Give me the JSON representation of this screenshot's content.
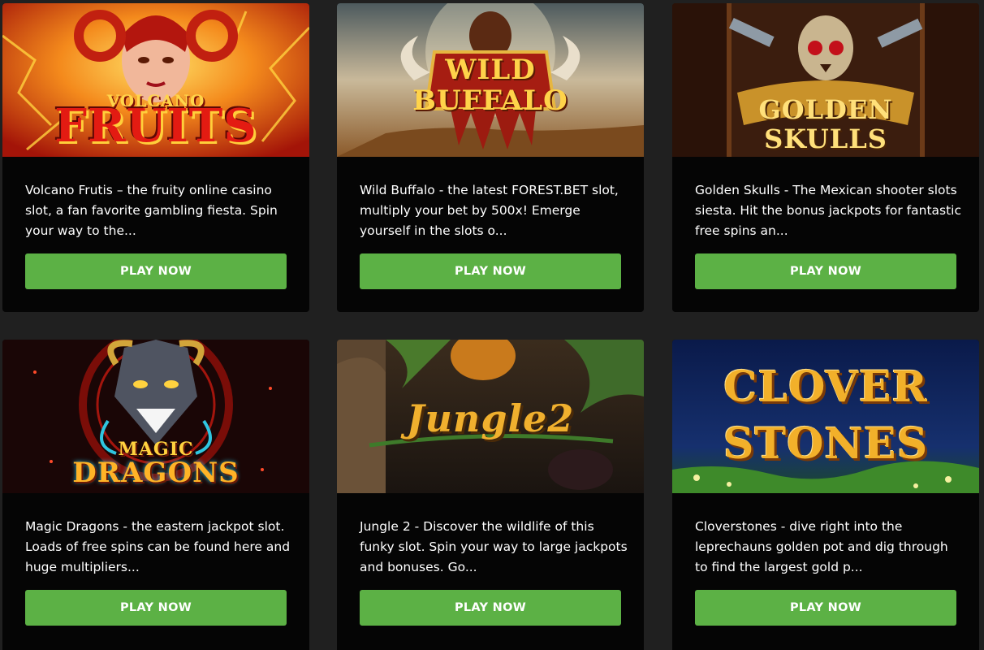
{
  "cards": [
    {
      "logo_line1": "VOLCANO",
      "logo_line2": "FRUITS",
      "description": "Volcano Frutis – the fruity online casino slot, a fan favorite gambling fiesta. Spin your way to the...",
      "button": "PLAY NOW"
    },
    {
      "logo_line1": "WILD",
      "logo_line2": "BUFFALO",
      "description": "Wild Buffalo - the latest FOREST.BET slot, multiply your bet by 500x! Emerge yourself in the slots o...",
      "button": "PLAY NOW"
    },
    {
      "logo_line1": "GOLDEN",
      "logo_line2": "SKULLS",
      "description": "Golden Skulls - The Mexican shooter slots siesta. Hit the bonus jackpots for fantastic free spins an...",
      "button": "PLAY NOW"
    },
    {
      "logo_line1": "MAGIC",
      "logo_line2": "DRAGONS",
      "description": "Magic Dragons - the eastern jackpot slot. Loads of free spins can be found here and huge multipliers...",
      "button": "PLAY NOW"
    },
    {
      "logo_line1": "Jungle2",
      "description": "Jungle 2 - Discover the wildlife of this funky slot. Spin your way to large jackpots and bonuses. Go...",
      "button": "PLAY NOW"
    },
    {
      "logo_line1": "CLOVER",
      "logo_line2": "STONES",
      "description": "Cloverstones - dive right into the leprechauns golden pot and dig through to find the largest gold p...",
      "button": "PLAY NOW"
    }
  ],
  "colors": {
    "page_background": "#202020",
    "card_background": "#050505",
    "button_green": "#5cb145",
    "text": "#ffffff"
  }
}
